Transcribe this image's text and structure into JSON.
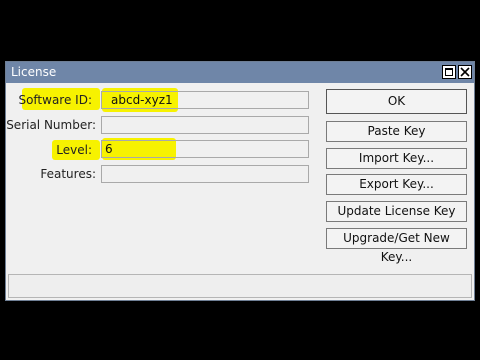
{
  "window": {
    "title": "License",
    "maximize_icon": "maximize-icon",
    "close_icon": "close-icon"
  },
  "form": {
    "software_id_label": "Software ID:",
    "software_id_value": "abcd-xyz1",
    "serial_number_label": "Serial Number:",
    "serial_number_value": "",
    "level_label": "Level:",
    "level_value": "6",
    "features_label": "Features:",
    "features_value": ""
  },
  "buttons": {
    "ok": "OK",
    "paste_key": "Paste Key",
    "import_key": "Import Key...",
    "export_key": "Export Key...",
    "update_license_key": "Update License Key",
    "upgrade_get_new_key": "Upgrade/Get New Key..."
  },
  "highlight_color": "#f7f200",
  "title_bar_color": "#6f86a8"
}
